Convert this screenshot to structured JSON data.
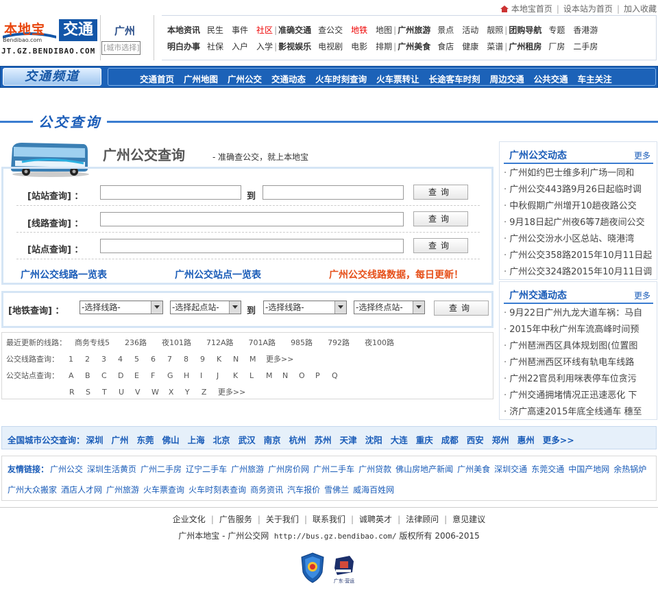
{
  "top_links": [
    "本地宝首页",
    "设本站为首页",
    "加入收藏"
  ],
  "logo": {
    "brand": "本地宝",
    "brand_sub": "Bendibao.com",
    "channel": "交通",
    "url": "JT.GZ.BENDIBAO.COM"
  },
  "city": {
    "name": "广州",
    "switch": "[城市选择]"
  },
  "topnav": {
    "row1": [
      {
        "t": "本地资讯",
        "b": true
      },
      {
        "t": "民生"
      },
      {
        "t": "事件"
      },
      {
        "t": "社区",
        "red": true
      },
      {
        "t": "|",
        "bar": true
      },
      {
        "t": "准确交通",
        "b": true
      },
      {
        "t": "查公交"
      },
      {
        "t": "地铁",
        "red": true
      },
      {
        "t": "地图"
      },
      {
        "t": "|",
        "bar": true
      },
      {
        "t": "广州旅游",
        "b": true
      },
      {
        "t": "景点"
      },
      {
        "t": "活动"
      },
      {
        "t": "靓照"
      },
      {
        "t": "|",
        "bar": true
      },
      {
        "t": "团购导航",
        "b": true
      },
      {
        "t": "专题"
      },
      {
        "t": "香港游"
      }
    ],
    "row2": [
      {
        "t": "明白办事",
        "b": true
      },
      {
        "t": "社保"
      },
      {
        "t": "入户"
      },
      {
        "t": "入学"
      },
      {
        "t": "|",
        "bar": true
      },
      {
        "t": "影视娱乐",
        "b": true
      },
      {
        "t": "电视剧"
      },
      {
        "t": "电影"
      },
      {
        "t": "排期"
      },
      {
        "t": "|",
        "bar": true
      },
      {
        "t": "广州美食",
        "b": true
      },
      {
        "t": "食店"
      },
      {
        "t": "健康"
      },
      {
        "t": "菜谱"
      },
      {
        "t": "|",
        "bar": true
      },
      {
        "t": "广州租房",
        "b": true
      },
      {
        "t": "厂房"
      },
      {
        "t": "二手房"
      }
    ]
  },
  "channel": {
    "title": "交通频道",
    "items": [
      "交通首页",
      "广州地图",
      "广州公交",
      "交通动态",
      "火车时刻查询",
      "火车票转让",
      "长途客车时刻",
      "周边交通",
      "公共交通",
      "车主关注"
    ]
  },
  "section_title": "公交查询",
  "main": {
    "title": "广州公交查询",
    "subtitle": "- 准确查公交，就上本地宝",
    "station_label": "[站站查询] ：",
    "to": "到",
    "line_label": "[线路查询] ：",
    "stop_label": "[站点查询] ：",
    "query_btn": "查询",
    "link1": "广州公交线路一览表",
    "link2": "广州公交站点一览表",
    "link3": "广州公交线路数据，每日更新！"
  },
  "subway": {
    "label": "[地铁查询] ：",
    "sel1": "-选择线路-",
    "sel2": "-选择起点站-",
    "to": "到",
    "sel3": "-选择线路-",
    "sel4": "-选择终点站-",
    "btn": "查询"
  },
  "recent": {
    "label": "最近更新的线路：",
    "lines": [
      "商务专线5",
      "236路",
      "夜101路",
      "712A路",
      "701A路",
      "985路",
      "792路",
      "夜100路"
    ],
    "route_label": "公交线路查询：",
    "route_keys": [
      "1",
      "2",
      "3",
      "4",
      "5",
      "6",
      "7",
      "8",
      "9",
      "K",
      "N",
      "M",
      "更多>>"
    ],
    "stop_label": "公交站点查询：",
    "stop_keys1": [
      "A",
      "B",
      "C",
      "D",
      "E",
      "F",
      "G",
      "H",
      "I",
      "J",
      "K",
      "L",
      "M",
      "N",
      "O",
      "P",
      "Q"
    ],
    "stop_keys2": [
      "R",
      "S",
      "T",
      "U",
      "V",
      "W",
      "X",
      "Y",
      "Z",
      "更多>>"
    ]
  },
  "side1": {
    "title": "广州公交动态",
    "more": "更多",
    "items": [
      "广州如约巴士维多利广场一同和",
      "广州公交443路9月26日起临时调",
      "中秋假期广州增开10趟夜路公交",
      "9月18日起广州夜6等7趟夜间公交",
      "广州公交汾水小区总站、晓港湾",
      "广州公交358路2015年10月11日起",
      "广州公交324路2015年10月11日调"
    ]
  },
  "side2": {
    "title": "广州交通动态",
    "more": "更多",
    "items": [
      "9月22日广州九龙大道车祸：马自",
      "2015年中秋广州车流高峰时间预",
      "广州琶洲西区具体规划图(位置图",
      "广州琶洲西区环线有轨电车线路",
      "广州22官员利用咪表停车位贪污",
      "广州交通拥堵情况正迅速恶化 下",
      "济广高速2015年底全线通车 穗至"
    ]
  },
  "cities": {
    "label": "全国城市公交查询：",
    "items": [
      "深圳",
      "广州",
      "东莞",
      "佛山",
      "上海",
      "北京",
      "武汉",
      "南京",
      "杭州",
      "苏州",
      "天津",
      "沈阳",
      "大连",
      "重庆",
      "成都",
      "西安",
      "郑州",
      "惠州",
      "更多>>"
    ]
  },
  "friends": {
    "label": "友情链接：",
    "row1": [
      "广州公交",
      "深圳生活黄页",
      "广州二手房",
      "辽宁二手车",
      "广州旅游",
      "广州房价网",
      "广州二手车",
      "广州贷款",
      "佛山房地产新闻",
      "广州美食",
      "深圳交通",
      "东莞交通",
      "中国产地网",
      "余热锅炉"
    ],
    "row2": [
      "广州大众搬家",
      "酒店人才网",
      "广州旅游",
      "火车票查询",
      "火车时刻表查询",
      "商务资讯",
      "汽车报价",
      "雪佛兰",
      "威海百姓网"
    ]
  },
  "footer": {
    "links": [
      "企业文化",
      "广告服务",
      "关于我们",
      "联系我们",
      "诚聘英才",
      "法律顾问",
      "意见建议"
    ],
    "copy_a": "广州本地宝 - 广州公交网",
    "copy_url": "http://bus.gz.bendibao.com/",
    "copy_b": "版权所有 2006-2015",
    "badge2_text": "广东·营运"
  },
  "colors": {
    "accent": "#1a5cb8",
    "channel_bar": "#1c62b8",
    "highlight": "#e6501a"
  }
}
